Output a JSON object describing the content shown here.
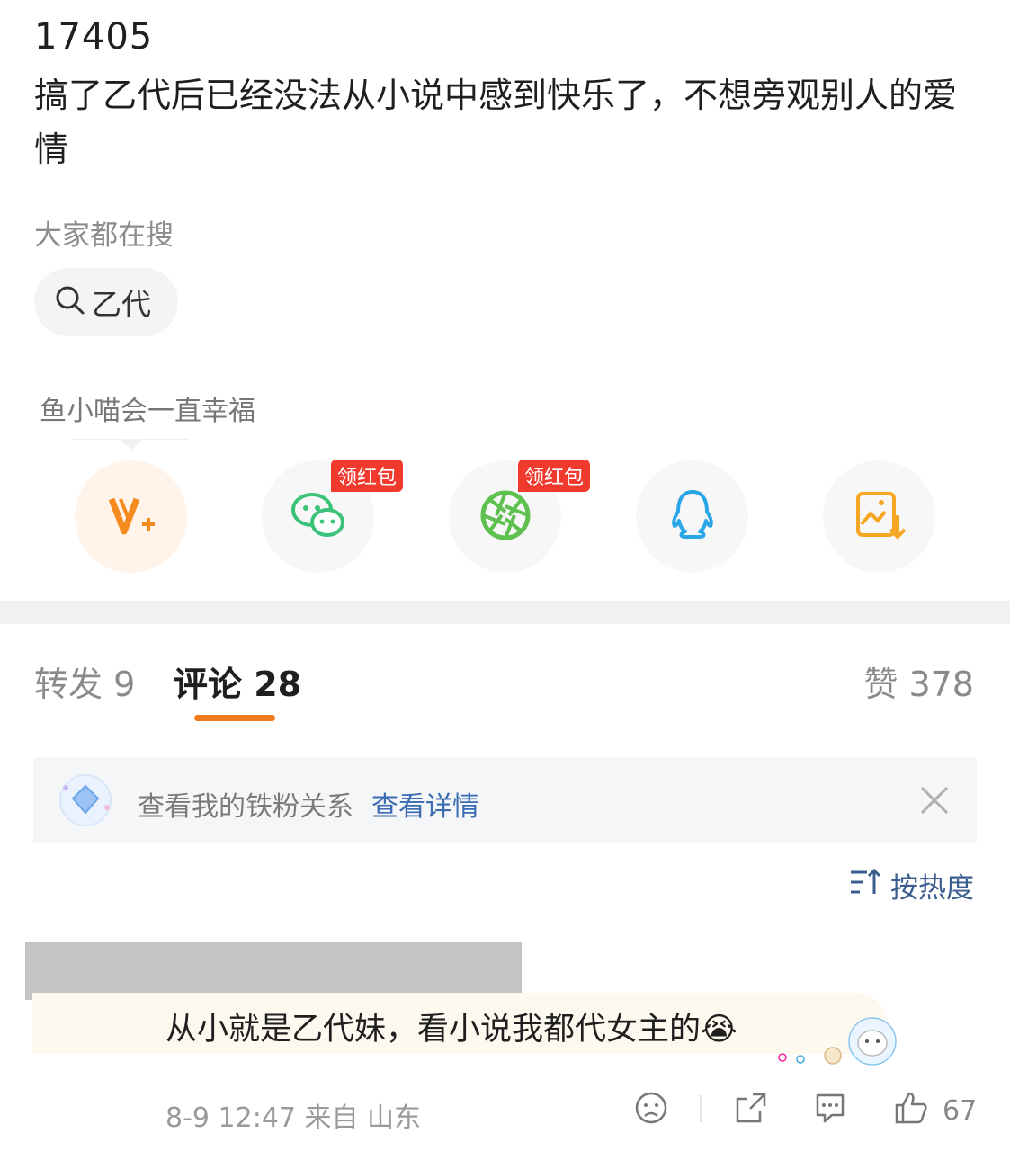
{
  "post": {
    "id": "17405",
    "text": "搞了乙代后已经没法从小说中感到快乐了，不想旁观别人的爱情"
  },
  "hot_search": {
    "label": "大家都在搜",
    "chip_text": "乙代",
    "chip_icon": "search-icon"
  },
  "share": {
    "tooltip": "鱼小喵会一直幸福",
    "items": [
      {
        "name": "weibo-vplus",
        "icon": "vplus-icon",
        "color": "#f58a1f"
      },
      {
        "name": "wechat",
        "icon": "wechat-icon",
        "color": "#3cc37a",
        "badge": "领红包"
      },
      {
        "name": "moments",
        "icon": "moments-icon",
        "color": "#5ec04f",
        "badge": "领红包"
      },
      {
        "name": "qq",
        "icon": "qq-icon",
        "color": "#2aa6e8"
      },
      {
        "name": "save-image",
        "icon": "save-image-icon",
        "color": "#f5a623"
      }
    ]
  },
  "tabs": {
    "repost": "转发 9",
    "comments": "评论 28",
    "likes": "赞 378",
    "accent": "#f07a1a"
  },
  "fan_bar": {
    "text": "查看我的铁粉关系",
    "link": "查看详情"
  },
  "sort": {
    "label": "按热度"
  },
  "comment": {
    "text": "从小就是乙代妹，看小说我都代女主的",
    "emoji": "😭",
    "meta": "8-9 12:47  来自 山东",
    "like_count": "67"
  }
}
